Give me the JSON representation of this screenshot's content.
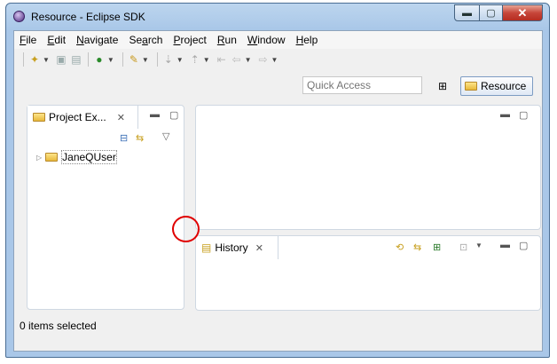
{
  "window": {
    "title": "Resource - Eclipse SDK"
  },
  "menu": [
    {
      "id": "file",
      "pre": "",
      "u": "F",
      "post": "ile"
    },
    {
      "id": "edit",
      "pre": "",
      "u": "E",
      "post": "dit"
    },
    {
      "id": "navigate",
      "pre": "",
      "u": "N",
      "post": "avigate"
    },
    {
      "id": "search",
      "pre": "Se",
      "u": "a",
      "post": "rch"
    },
    {
      "id": "project",
      "pre": "",
      "u": "P",
      "post": "roject"
    },
    {
      "id": "run",
      "pre": "",
      "u": "R",
      "post": "un"
    },
    {
      "id": "window",
      "pre": "",
      "u": "W",
      "post": "indow"
    },
    {
      "id": "help",
      "pre": "",
      "u": "H",
      "post": "elp"
    }
  ],
  "toolbar": {
    "quick_access_placeholder": "Quick Access",
    "perspective": "Resource"
  },
  "project_explorer": {
    "tab": "Project Ex...",
    "items": [
      "JaneQUser"
    ]
  },
  "history": {
    "tab": "History"
  },
  "status": {
    "text": "0 items selected"
  },
  "colors": {
    "accent": "#a9c7e8",
    "close_button": "#c7463a",
    "highlight_circle": "#e00000"
  }
}
